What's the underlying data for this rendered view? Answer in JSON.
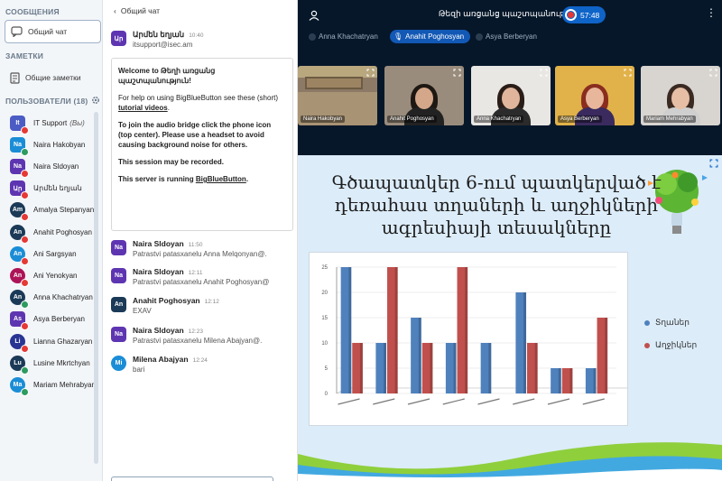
{
  "left": {
    "messages_title": "СООБЩЕНИЯ",
    "public_chat": "Общий чат",
    "notes_title": "ЗАМЕТКИ",
    "shared_notes": "Общие заметки",
    "users_title": "ПОЛЬЗОВАТЕЛИ (18)",
    "users": [
      {
        "initials": "It",
        "name": "IT Support",
        "you": "(Вы)",
        "color": "#4b5cc4",
        "mic": "red"
      },
      {
        "initials": "Na",
        "name": "Naira Hakobyan",
        "color": "#1a8dd6",
        "mic": "green"
      },
      {
        "initials": "Na",
        "name": "Naira Sldoyan",
        "color": "#5e35b1",
        "mic": "red"
      },
      {
        "initials": "Ար",
        "name": "Արմեն եղյան",
        "color": "#5e35b1",
        "mic": "red"
      },
      {
        "initials": "Am",
        "name": "Amalya Stepanyan",
        "color": "#1b3a57",
        "mic": "red"
      },
      {
        "initials": "An",
        "name": "Anahit Poghosyan",
        "color": "#1b3a57",
        "mic": "red"
      },
      {
        "initials": "An",
        "name": "Ani Sargsyan",
        "color": "#1a8dd6",
        "mic": "red"
      },
      {
        "initials": "An",
        "name": "Ani Yenokyan",
        "color": "#ad1457",
        "mic": "red"
      },
      {
        "initials": "An",
        "name": "Anna Khachatryan",
        "color": "#1b3a57",
        "mic": "green"
      },
      {
        "initials": "As",
        "name": "Asya Berberyan",
        "color": "#5e35b1",
        "mic": "red"
      },
      {
        "initials": "Li",
        "name": "Lianna Ghazaryan",
        "color": "#283593",
        "mic": "red"
      },
      {
        "initials": "Lu",
        "name": "Lusine Mkrtchyan",
        "color": "#1b3a57",
        "mic": "green"
      },
      {
        "initials": "Ma",
        "name": "Mariam Mehrabyan",
        "color": "#1a8dd6",
        "mic": "green"
      }
    ]
  },
  "chat": {
    "back_label": "Общий чат",
    "sender1": {
      "initials": "Ար",
      "name": "Արմեն եղյան",
      "time": "10:40",
      "body": "itsupport@isec.am"
    },
    "welcome": {
      "l1a": "Welcome to ",
      "l1b": "Թեղի առցանց պաշտպանություն!",
      "l2a": "For help on using BigBlueButton see these (short) ",
      "l2link": "tutorial videos",
      "l2b": ".",
      "l3": "To join the audio bridge click the phone icon (top center). Please use a headset to avoid causing background noise for others.",
      "l4": "This session may be recorded.",
      "l5a": "This server is running ",
      "l5link": "BigBlueButton",
      "l5b": "."
    },
    "messages": [
      {
        "initials": "Na",
        "name": "Naira Sldoyan",
        "time": "11:50",
        "body": "Patrastvi patasxanelu Anna Melqonyan@.",
        "color": "#5e35b1"
      },
      {
        "initials": "Na",
        "name": "Naira Sldoyan",
        "time": "12:11",
        "body": "Patrastvi patasxanelu Anahit Poghosyan@",
        "color": "#5e35b1"
      },
      {
        "initials": "An",
        "name": "Anahit Poghosyan",
        "time": "12:12",
        "body": "EXAV",
        "color": "#1b3a57"
      },
      {
        "initials": "Na",
        "name": "Naira Sldoyan",
        "time": "12:23",
        "body": "Patrastvi patasxanelu Milena Abajyan@.",
        "color": "#5e35b1"
      },
      {
        "initials": "Mi",
        "name": "Milena Abajyan",
        "time": "12:24",
        "body": "bari",
        "color": "#1a8dd6"
      }
    ]
  },
  "main": {
    "title": "Թեզի առցանց պաշտպանություն",
    "timer": "57:48",
    "talkers": [
      "Anna Khachatryan",
      "Anahit Poghosyan",
      "Asya Berberyan"
    ],
    "videos": [
      "Naira Hakobyan",
      "Anahit Poghosyan",
      "Anna Khachatryan",
      "Asya Berberyan",
      "Mariam Mehrabyan"
    ],
    "accent": "#0f64c8"
  },
  "slide": {
    "title_l1": "Գծապատկեր 6-ում պատկերված է",
    "title_l2": "դեռահաս տղաների և աղջիկների",
    "title_l3": "ագրեսիայի տեսակները",
    "legend": [
      "Տղաներ",
      "Աղջիկներ"
    ]
  },
  "chart_data": {
    "type": "bar",
    "categories": [
      "",
      "",
      "",
      "",
      "",
      "",
      "",
      ""
    ],
    "series": [
      {
        "name": "Տղաներ",
        "values": [
          25,
          10,
          15,
          10,
          10,
          20,
          5,
          5
        ],
        "color": "#4f81bd"
      },
      {
        "name": "Աղջիկներ",
        "values": [
          10,
          25,
          10,
          25,
          0,
          10,
          5,
          15
        ],
        "color": "#c0504d"
      }
    ],
    "ylim": [
      0,
      25
    ],
    "yticks": [
      0,
      5,
      10,
      15,
      20,
      25
    ]
  }
}
